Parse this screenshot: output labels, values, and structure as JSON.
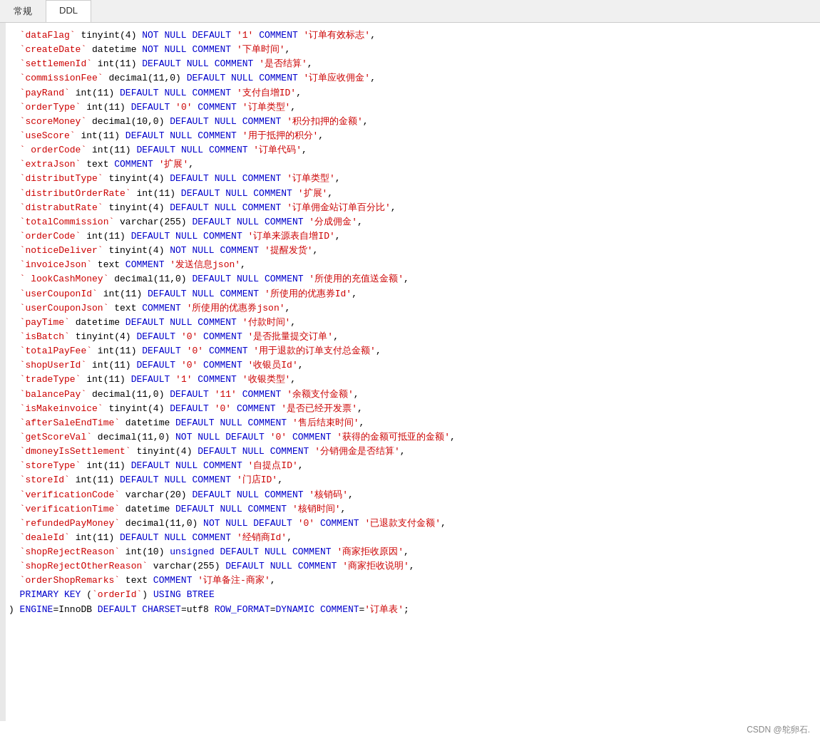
{
  "tabs": [
    {
      "label": "常规",
      "active": false
    },
    {
      "label": "DDL",
      "active": true
    }
  ],
  "watermark": "CSDN @鸵卵石.",
  "lines": [
    {
      "text": "  `dataFlag` tinyint(4) NOT NULL DEFAULT '1' COMMENT '订单有效标志',"
    },
    {
      "text": "  `createDate` datetime NOT NULL COMMENT '下单时间',"
    },
    {
      "text": "  `settlemenId` int(11) DEFAULT NULL COMMENT '是否结算',"
    },
    {
      "text": "  `commissionFee` decimal(11,0) DEFAULT NULL COMMENT '订单应收佣金',"
    },
    {
      "text": "  `payRand` int(11) DEFAULT NULL COMMENT '支付自增ID',"
    },
    {
      "text": "  `orderType` int(11) DEFAULT '0' COMMENT '订单类型',"
    },
    {
      "text": "  `scoreMoney` decimal(10,0) DEFAULT NULL COMMENT '积分扣押的金额',"
    },
    {
      "text": "  `useScore` int(11) DEFAULT NULL COMMENT '用于抵押的积分',"
    },
    {
      "text": "  ` orderCode` int(11) DEFAULT NULL COMMENT '订单代码',"
    },
    {
      "text": "  `extraJson` text COMMENT '扩展',"
    },
    {
      "text": "  `distributType` tinyint(4) DEFAULT NULL COMMENT '订单类型',"
    },
    {
      "text": "  `distributOrderRate` int(11) DEFAULT NULL COMMENT '扩展',"
    },
    {
      "text": "  `distrabutRate` tinyint(4) DEFAULT NULL COMMENT '订单佣金站订单百分比',"
    },
    {
      "text": "  `totalCommission` varchar(255) DEFAULT NULL COMMENT '分成佣金',"
    },
    {
      "text": "  `orderCode` int(11) DEFAULT NULL COMMENT '订单来源表自增ID',"
    },
    {
      "text": "  `noticeDeliver` tinyint(4) NOT NULL COMMENT '提醒发货',"
    },
    {
      "text": "  `invoiceJson` text COMMENT '发送信息json',"
    },
    {
      "text": "  ` lookCashMoney` decimal(11,0) DEFAULT NULL COMMENT '所使用的充值送金额',"
    },
    {
      "text": "  `userCouponId` int(11) DEFAULT NULL COMMENT '所使用的优惠券Id',"
    },
    {
      "text": "  `userCouponJson` text COMMENT '所使用的优惠券json',"
    },
    {
      "text": "  `payTime` datetime DEFAULT NULL COMMENT '付款时间',"
    },
    {
      "text": "  `isBatch` tinyint(4) DEFAULT '0' COMMENT '是否批量提交订单',"
    },
    {
      "text": "  `totalPayFee` int(11) DEFAULT '0' COMMENT '用于退款的订单支付总金额',"
    },
    {
      "text": "  `shopUserId` int(11) DEFAULT '0' COMMENT '收银员Id',"
    },
    {
      "text": "  `tradeType` int(11) DEFAULT '1' COMMENT '收银类型',"
    },
    {
      "text": "  `balancePay` decimal(11,0) DEFAULT '11' COMMENT '余额支付金额',"
    },
    {
      "text": "  `isMakeinvoice` tinyint(4) DEFAULT '0' COMMENT '是否已经开发票',"
    },
    {
      "text": "  `afterSaleEndTime` datetime DEFAULT NULL COMMENT '售后结束时间',"
    },
    {
      "text": "  `getScoreVal` decimal(11,0) NOT NULL DEFAULT '0' COMMENT '获得的金额可抵亚的金额',"
    },
    {
      "text": "  `dmoneyIsSettlement` tinyint(4) DEFAULT NULL COMMENT '分销佣金是否结算',"
    },
    {
      "text": "  `storeType` int(11) DEFAULT NULL COMMENT '自提点ID',"
    },
    {
      "text": "  `storeId` int(11) DEFAULT NULL COMMENT '门店ID',"
    },
    {
      "text": "  `verificationCode` varchar(20) DEFAULT NULL COMMENT '核销码',"
    },
    {
      "text": "  `verificationTime` datetime DEFAULT NULL COMMENT '核销时间',"
    },
    {
      "text": "  `refundedPayMoney` decimal(11,0) NOT NULL DEFAULT '0' COMMENT '已退款支付金额',"
    },
    {
      "text": "  `dealeId` int(11) DEFAULT NULL COMMENT '经销商Id',"
    },
    {
      "text": "  `shopRejectReason` int(10) unsigned DEFAULT NULL COMMENT '商家拒收原因',"
    },
    {
      "text": "  `shopRejectOtherReason` varchar(255) DEFAULT NULL COMMENT '商家拒收说明',"
    },
    {
      "text": "  `orderShopRemarks` text COMMENT '订单备注-商家',"
    },
    {
      "text": "  PRIMARY KEY (`orderId`) USING BTREE"
    },
    {
      "text": ") ENGINE=InnoDB DEFAULT CHARSET=utf8 ROW_FORMAT=DYNAMIC COMMENT='订单表';"
    }
  ]
}
